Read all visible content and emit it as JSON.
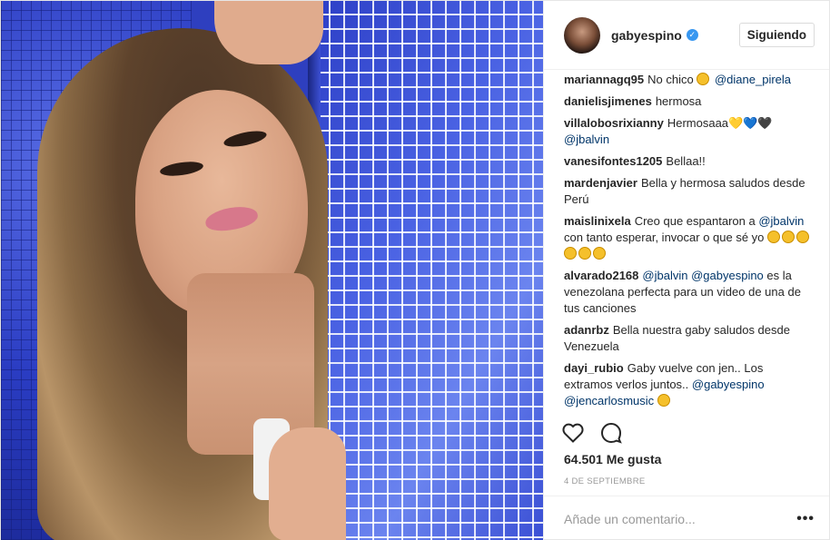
{
  "post": {
    "author": {
      "username": "gabyespino",
      "verified_icon": "check-badge-icon",
      "follow_label": "Siguiendo"
    },
    "comments": [
      {
        "user": "mariannagq95",
        "parts": [
          {
            "t": "No chico "
          },
          {
            "emoji": "laughing-emoji"
          },
          {
            "t": " "
          },
          {
            "m": "@diane_pirela"
          }
        ]
      },
      {
        "user": "danielisjimenes",
        "parts": [
          {
            "t": "hermosa"
          }
        ]
      },
      {
        "user": "villalobosrixianny",
        "parts": [
          {
            "t": "Hermosaaa"
          },
          {
            "h": "💛💙🖤"
          },
          {
            "t": " "
          },
          {
            "m": "@jbalvin"
          }
        ]
      },
      {
        "user": "vanesifontes1205",
        "parts": [
          {
            "t": "Bellaa!!"
          }
        ]
      },
      {
        "user": "mardenjavier",
        "parts": [
          {
            "t": "Bella y hermosa saludos desde Perú"
          }
        ]
      },
      {
        "user": "maislinixela",
        "parts": [
          {
            "t": "Creo que espantaron a "
          },
          {
            "m": "@jbalvin"
          },
          {
            "t": " con tanto esperar, invocar o que sé yo "
          },
          {
            "emoji": "laughing-emoji"
          },
          {
            "emoji": "laughing-emoji"
          },
          {
            "emoji": "laughing-emoji"
          },
          {
            "emoji": "laughing-emoji"
          },
          {
            "emoji": "laughing-emoji"
          },
          {
            "emoji": "laughing-emoji"
          }
        ]
      },
      {
        "user": "alvarado2168",
        "parts": [
          {
            "m": "@jbalvin"
          },
          {
            "t": " "
          },
          {
            "m": "@gabyespino"
          },
          {
            "t": " es la venezolana perfecta para un video de una de tus canciones"
          }
        ]
      },
      {
        "user": "adanrbz",
        "parts": [
          {
            "t": "Bella nuestra gaby saludos desde Venezuela"
          }
        ]
      },
      {
        "user": "dayi_rubio",
        "parts": [
          {
            "t": "Gaby vuelve con jen.. Los extramos verlos juntos.. "
          },
          {
            "m": "@gabyespino"
          },
          {
            "t": " "
          },
          {
            "m": "@jencarlosmusic"
          },
          {
            "t": " "
          },
          {
            "emoji": "sad-emoji"
          }
        ]
      }
    ],
    "actions": {
      "like_icon": "heart-icon",
      "comment_icon": "comment-bubble-icon"
    },
    "likes_text": "64.501 Me gusta",
    "date_text": "4 DE SEPTIEMBRE",
    "add_comment_placeholder": "Añade un comentario...",
    "more_label": "•••"
  }
}
